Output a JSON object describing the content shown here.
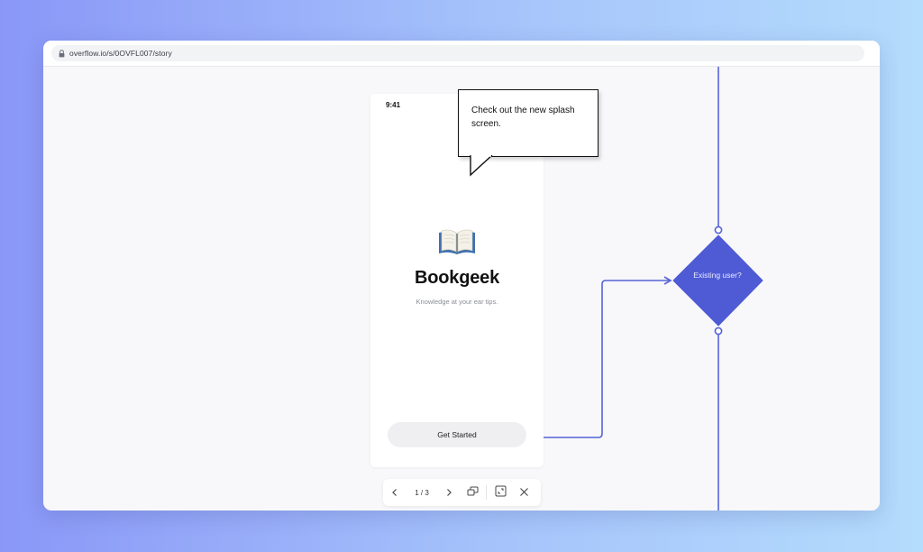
{
  "browser": {
    "url": "overflow.io/s/0OVFL007/story"
  },
  "phone": {
    "status_time": "9:41",
    "app_title": "Bookgeek",
    "app_subtitle": "Knowledge at your ear tips.",
    "cta_label": "Get Started"
  },
  "comment": {
    "text": "Check out the new splash screen."
  },
  "flow": {
    "decision_label": "Existing user?",
    "accent_color": "#5563d8",
    "decision_color": "#4f5bd5"
  },
  "toolbar": {
    "page_indicator": "1 / 3",
    "icons": [
      "chevron-left-icon",
      "chevron-right-icon",
      "present-icon",
      "fit-screen-icon",
      "close-icon"
    ]
  }
}
